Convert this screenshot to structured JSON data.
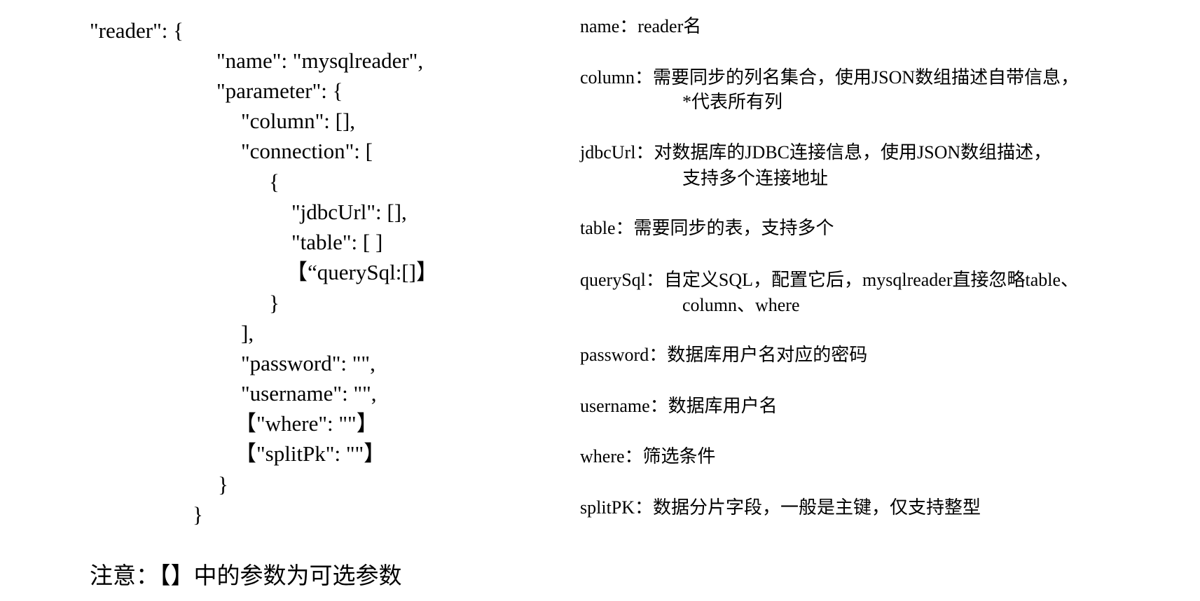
{
  "code_lines": [
    "\"reader\": {",
    "\"name\": \"mysqlreader\",",
    "\"parameter\": {",
    "\"column\": [],",
    "\"connection\": [",
    "{",
    "\"jdbcUrl\": [],",
    "\"table\": [ ]",
    "【“querySql:[]】",
    "}",
    "],",
    "\"password\": \"\",",
    "\"username\": \"\",",
    "【\"where\": \"\"】",
    "【\"splitPk\": \"\"】",
    "}",
    "}"
  ],
  "descriptions": [
    {
      "line1": "name：reader名"
    },
    {
      "line1": "column：需要同步的列名集合，使用JSON数组描述自带信息，",
      "line2": "*代表所有列"
    },
    {
      "line1": "jdbcUrl：对数据库的JDBC连接信息，使用JSON数组描述，",
      "line2": "支持多个连接地址"
    },
    {
      "line1": "table：需要同步的表，支持多个"
    },
    {
      "line1": "querySql：自定义SQL，配置它后，mysqlreader直接忽略table、",
      "line2": "column、where"
    },
    {
      "line1": "password：数据库用户名对应的密码"
    },
    {
      "line1": "username：数据库用户名"
    },
    {
      "line1": "where：筛选条件"
    },
    {
      "line1": "splitPK：数据分片字段，一般是主键，仅支持整型"
    }
  ],
  "note": "注意：【】中的参数为可选参数"
}
